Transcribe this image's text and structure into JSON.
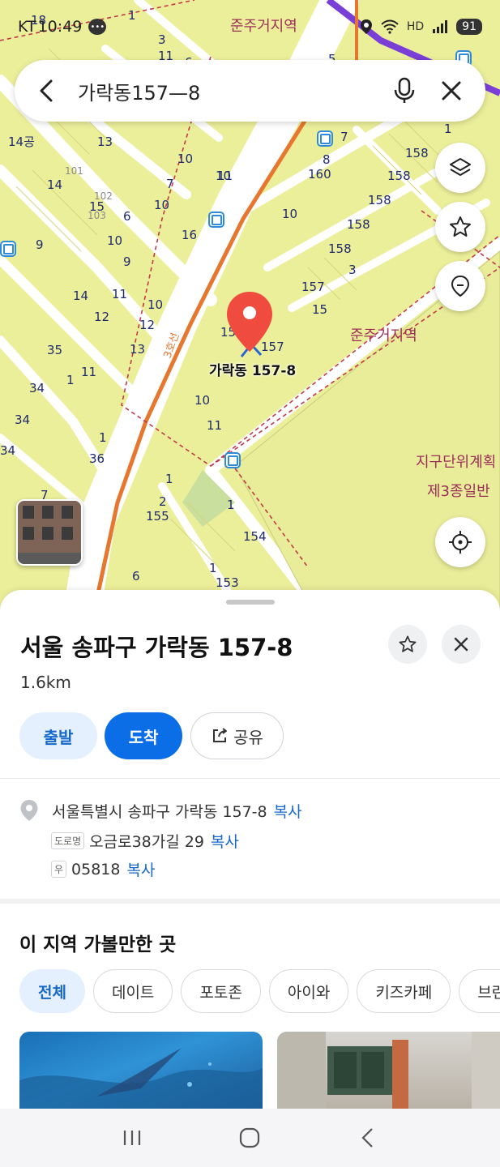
{
  "status_bar": {
    "carrier": "KT",
    "time": "10:49",
    "battery": "91"
  },
  "search": {
    "query": "가락동157—8"
  },
  "map": {
    "zone_labels": [
      "준주거지역",
      "준주거지역",
      "지구단위계획",
      "제3종일반"
    ],
    "marker_label": "가락동 157-8",
    "lot_numbers": [
      "18",
      "1",
      "3",
      "11",
      "6",
      "5",
      "14공",
      "13",
      "101",
      "102",
      "103",
      "14",
      "15",
      "6",
      "10",
      "9",
      "10",
      "7",
      "10",
      "16",
      "10",
      "9",
      "14",
      "11",
      "12",
      "10",
      "12",
      "13",
      "35",
      "11",
      "1",
      "34",
      "34",
      "34",
      "36",
      "1",
      "7",
      "1",
      "2",
      "155",
      "1",
      "154",
      "1",
      "153",
      "6",
      "7",
      "8",
      "160",
      "10",
      "11",
      "158",
      "158",
      "158",
      "158",
      "158",
      "3",
      "157",
      "15",
      "15",
      "157",
      "10",
      "11",
      "1"
    ],
    "road_label": "3호선"
  },
  "place": {
    "title": "서울 송파구 가락동 157-8",
    "distance": "1.6km",
    "buttons": {
      "start": "출발",
      "arrive": "도착",
      "share": "공유"
    },
    "address": {
      "jibun": "서울특별시 송파구 가락동 157-8",
      "road_tag": "도로명",
      "road": "오금로38가길 29",
      "zip_tag": "우",
      "zip": "05818",
      "copy": "복사"
    }
  },
  "nearby": {
    "title": "이 지역 가볼만한 곳",
    "chips": [
      "전체",
      "데이트",
      "포토존",
      "아이와",
      "키즈카페",
      "브런치"
    ]
  },
  "colors": {
    "accent": "#0b6ee6",
    "accent_light": "#e4f0fd",
    "map_base": "#ecef9a",
    "marker": "#ef4b3f",
    "subway_line": "#e7772f",
    "zone_text": "#9c2f5a"
  }
}
